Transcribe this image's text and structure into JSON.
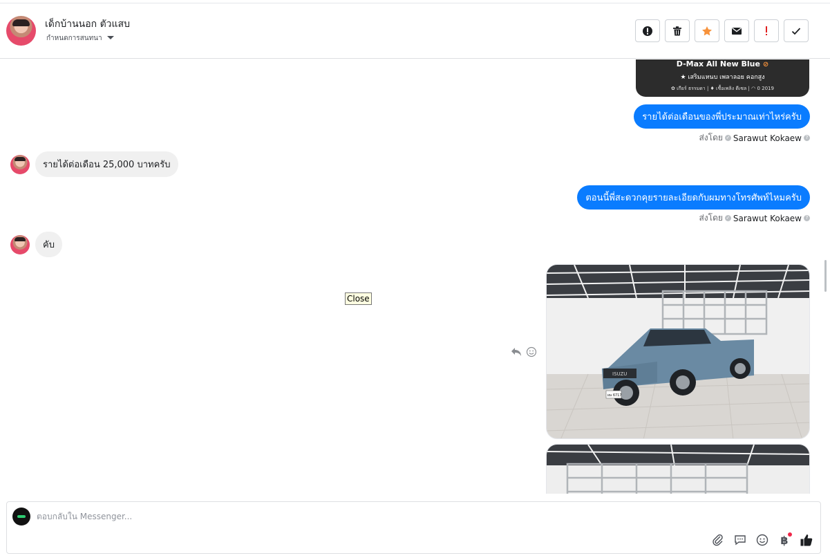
{
  "header": {
    "contact_name": "เด็กบ้านนอก ตัวแสบ",
    "status_label": "กำหนดการสนทนา",
    "actions": [
      "mark-spam",
      "delete",
      "star",
      "unread",
      "important",
      "done"
    ]
  },
  "conversation": {
    "card": {
      "title": "D-Max All New Blue",
      "subtitle": "★ เสริมแหนบ เพลาลอย คอกสูง",
      "specs": "✿ เกียร์ ธรรมดา | ♦ เชื้อเพลิง ดีเซล | ◠ 0 2019"
    },
    "messages": [
      {
        "direction": "out",
        "text": "รายได้ต่อเดือนของพี่ประมาณเท่าไหร่ครับ",
        "sent_by_label": "ส่งโดย",
        "sender": "Sarawut Kokaew"
      },
      {
        "direction": "in",
        "text": "รายได้ต่อเดือน 25,000 บาทครับ"
      },
      {
        "direction": "out",
        "text": "ตอนนี้พี่สะดวกคุยรายละเอียดกับผมทางโทรศัพท์ไหมครับ",
        "sent_by_label": "ส่งโดย",
        "sender": "Sarawut Kokaew"
      },
      {
        "direction": "in",
        "text": "คับ"
      }
    ],
    "tooltip": "Close",
    "photo_plate": "ผษ 6717"
  },
  "composer": {
    "placeholder": "ตอบกลับใน Messenger...",
    "tools": [
      "attach-icon",
      "saved-replies-icon",
      "emoji-icon",
      "payment-icon",
      "like-icon"
    ]
  },
  "colors": {
    "outgoing_bubble": "#0a7cff",
    "incoming_bubble": "#f0f0f0",
    "star": "#f7923b",
    "important": "#e02020"
  }
}
